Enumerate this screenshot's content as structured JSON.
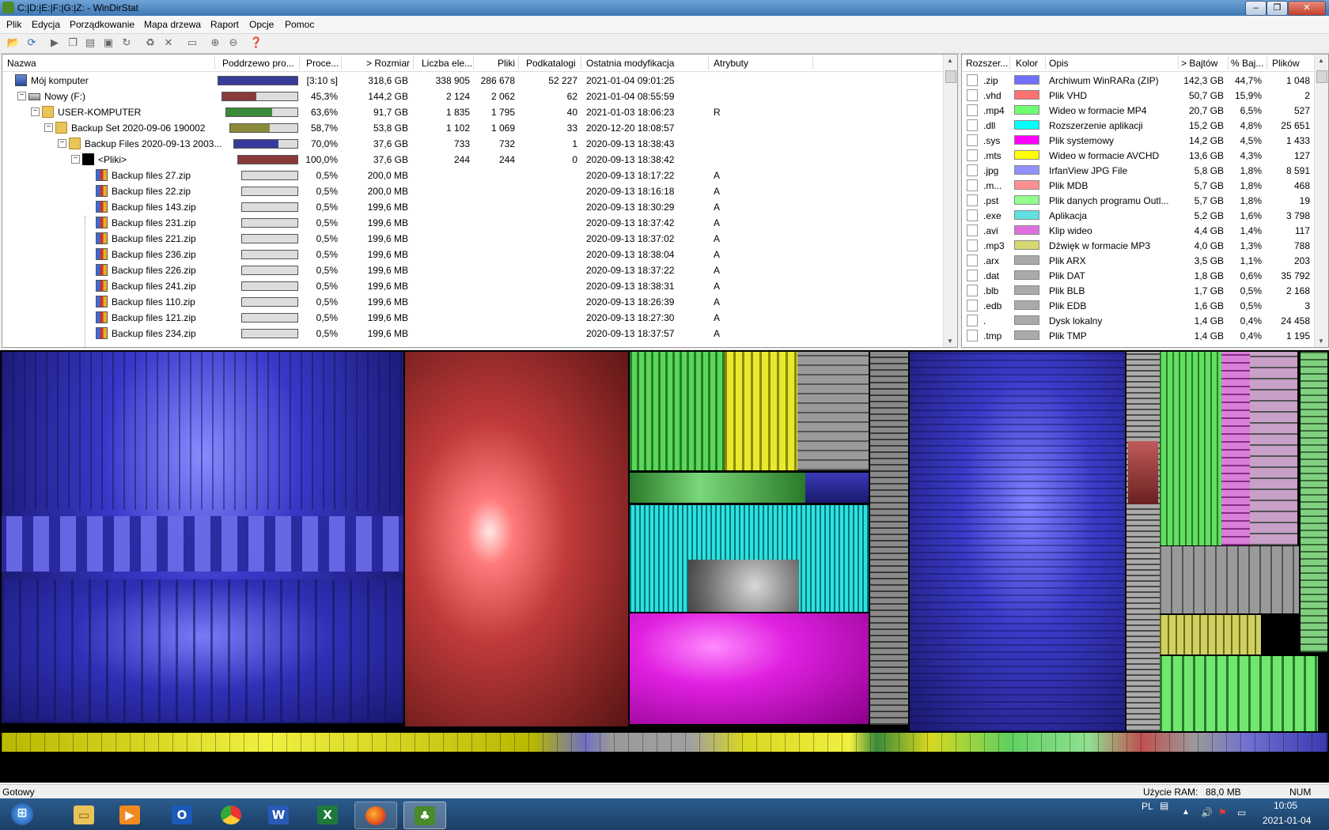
{
  "window": {
    "title": "C:|D:|E:|F:|G:|Z: - WinDirStat"
  },
  "menu": [
    "Plik",
    "Edycja",
    "Porządkowanie",
    "Mapa drzewa",
    "Raport",
    "Opcje",
    "Pomoc"
  ],
  "toolbar_icons": [
    "open-icon",
    "refresh-icon",
    "play-icon",
    "copy-icon",
    "paste-icon",
    "cmd-icon",
    "undo-icon",
    "recycle-icon",
    "delete-icon",
    "folder-icon",
    "zoom-in-icon",
    "zoom-out-icon",
    "help-icon"
  ],
  "tree": {
    "columns": [
      "Nazwa",
      "Poddrzewo pro...",
      "Proce...",
      "> Rozmiar",
      "Liczba ele...",
      "Pliki",
      "Podkatalogi",
      "Ostatnia modyfikacja",
      "Atrybuty"
    ],
    "rows": [
      {
        "name": "Mój komputer",
        "level": 0,
        "expander": "",
        "icon": "computer-icon",
        "percent": "[3:10 s]",
        "size": "318,6 GB",
        "items": "338 905",
        "files": "286 678",
        "subdirs": "52 227",
        "modified": "2021-01-04  09:01:25",
        "attr": "",
        "bar": 1.0,
        "barcolor": "#3a3a9a"
      },
      {
        "name": "Nowy (F:)",
        "level": 1,
        "expander": "−",
        "icon": "drive-icon",
        "percent": "45,3%",
        "size": "144,2 GB",
        "items": "2 124",
        "files": "2 062",
        "subdirs": "62",
        "modified": "2021-01-04  08:55:59",
        "attr": "",
        "bar": 0.453,
        "barcolor": "#8a3a3a"
      },
      {
        "name": "USER-KOMPUTER",
        "level": 2,
        "expander": "−",
        "icon": "folder-icon",
        "percent": "63,6%",
        "size": "91,7 GB",
        "items": "1 835",
        "files": "1 795",
        "subdirs": "40",
        "modified": "2021-01-03  18:06:23",
        "attr": "R",
        "bar": 0.636,
        "barcolor": "#3a8a3a"
      },
      {
        "name": "Backup Set 2020-09-06 190002",
        "level": 3,
        "expander": "−",
        "icon": "folder-icon",
        "percent": "58,7%",
        "size": "53,8 GB",
        "items": "1 102",
        "files": "1 069",
        "subdirs": "33",
        "modified": "2020-12-20  18:08:57",
        "attr": "",
        "bar": 0.587,
        "barcolor": "#8a8a3a"
      },
      {
        "name": "Backup Files 2020-09-13 2003...",
        "level": 4,
        "expander": "−",
        "icon": "folder-icon",
        "percent": "70,0%",
        "size": "37,6 GB",
        "items": "733",
        "files": "732",
        "subdirs": "1",
        "modified": "2020-09-13  18:38:43",
        "attr": "",
        "bar": 0.7,
        "barcolor": "#3a3a9a"
      },
      {
        "name": "<Pliki>",
        "level": 5,
        "expander": "−",
        "icon": "files-icon",
        "percent": "100,0%",
        "size": "37,6 GB",
        "items": "244",
        "files": "244",
        "subdirs": "0",
        "modified": "2020-09-13  18:38:42",
        "attr": "",
        "bar": 1.0,
        "barcolor": "#8a3a3a"
      },
      {
        "name": "Backup files 27.zip",
        "level": 6,
        "expander": "",
        "icon": "zip-icon",
        "percent": "0,5%",
        "size": "200,0 MB",
        "items": "",
        "files": "",
        "subdirs": "",
        "modified": "2020-09-13  18:17:22",
        "attr": "A",
        "bar": 0,
        "barcolor": "#888"
      },
      {
        "name": "Backup files 22.zip",
        "level": 6,
        "expander": "",
        "icon": "zip-icon",
        "percent": "0,5%",
        "size": "200,0 MB",
        "items": "",
        "files": "",
        "subdirs": "",
        "modified": "2020-09-13  18:16:18",
        "attr": "A",
        "bar": 0,
        "barcolor": "#888"
      },
      {
        "name": "Backup files 143.zip",
        "level": 6,
        "expander": "",
        "icon": "zip-icon",
        "percent": "0,5%",
        "size": "199,6 MB",
        "items": "",
        "files": "",
        "subdirs": "",
        "modified": "2020-09-13  18:30:29",
        "attr": "A",
        "bar": 0,
        "barcolor": "#888"
      },
      {
        "name": "Backup files 231.zip",
        "level": 6,
        "expander": "",
        "icon": "zip-icon",
        "percent": "0,5%",
        "size": "199,6 MB",
        "items": "",
        "files": "",
        "subdirs": "",
        "modified": "2020-09-13  18:37:42",
        "attr": "A",
        "bar": 0,
        "barcolor": "#888"
      },
      {
        "name": "Backup files 221.zip",
        "level": 6,
        "expander": "",
        "icon": "zip-icon",
        "percent": "0,5%",
        "size": "199,6 MB",
        "items": "",
        "files": "",
        "subdirs": "",
        "modified": "2020-09-13  18:37:02",
        "attr": "A",
        "bar": 0,
        "barcolor": "#888"
      },
      {
        "name": "Backup files 236.zip",
        "level": 6,
        "expander": "",
        "icon": "zip-icon",
        "percent": "0,5%",
        "size": "199,6 MB",
        "items": "",
        "files": "",
        "subdirs": "",
        "modified": "2020-09-13  18:38:04",
        "attr": "A",
        "bar": 0,
        "barcolor": "#888"
      },
      {
        "name": "Backup files 226.zip",
        "level": 6,
        "expander": "",
        "icon": "zip-icon",
        "percent": "0,5%",
        "size": "199,6 MB",
        "items": "",
        "files": "",
        "subdirs": "",
        "modified": "2020-09-13  18:37:22",
        "attr": "A",
        "bar": 0,
        "barcolor": "#888"
      },
      {
        "name": "Backup files 241.zip",
        "level": 6,
        "expander": "",
        "icon": "zip-icon",
        "percent": "0,5%",
        "size": "199,6 MB",
        "items": "",
        "files": "",
        "subdirs": "",
        "modified": "2020-09-13  18:38:31",
        "attr": "A",
        "bar": 0,
        "barcolor": "#888"
      },
      {
        "name": "Backup files 110.zip",
        "level": 6,
        "expander": "",
        "icon": "zip-icon",
        "percent": "0,5%",
        "size": "199,6 MB",
        "items": "",
        "files": "",
        "subdirs": "",
        "modified": "2020-09-13  18:26:39",
        "attr": "A",
        "bar": 0,
        "barcolor": "#888"
      },
      {
        "name": "Backup files 121.zip",
        "level": 6,
        "expander": "",
        "icon": "zip-icon",
        "percent": "0,5%",
        "size": "199,6 MB",
        "items": "",
        "files": "",
        "subdirs": "",
        "modified": "2020-09-13  18:27:30",
        "attr": "A",
        "bar": 0,
        "barcolor": "#888"
      },
      {
        "name": "Backup files 234.zip",
        "level": 6,
        "expander": "",
        "icon": "zip-icon",
        "percent": "0,5%",
        "size": "199,6 MB",
        "items": "",
        "files": "",
        "subdirs": "",
        "modified": "2020-09-13  18:37:57",
        "attr": "A",
        "bar": 0,
        "barcolor": "#888"
      }
    ]
  },
  "extensions": {
    "columns": [
      "Rozszer...",
      "Kolor",
      "Opis",
      "> Bajtów",
      "% Baj...",
      "Plików"
    ],
    "rows": [
      {
        "ext": ".zip",
        "color": "#7070ff",
        "desc": "Archiwum WinRARa (ZIP)",
        "bytes": "142,3 GB",
        "pct": "44,7%",
        "files": "1 048"
      },
      {
        "ext": ".vhd",
        "color": "#ff7070",
        "desc": "Plik VHD",
        "bytes": "50,7 GB",
        "pct": "15,9%",
        "files": "2"
      },
      {
        "ext": ".mp4",
        "color": "#70ff70",
        "desc": "Wideo w formacie MP4",
        "bytes": "20,7 GB",
        "pct": "6,5%",
        "files": "527"
      },
      {
        "ext": ".dll",
        "color": "#00ffff",
        "desc": "Rozszerzenie aplikacji",
        "bytes": "15,2 GB",
        "pct": "4,8%",
        "files": "25 651"
      },
      {
        "ext": ".sys",
        "color": "#ff00ff",
        "desc": "Plik systemowy",
        "bytes": "14,2 GB",
        "pct": "4,5%",
        "files": "1 433"
      },
      {
        "ext": ".mts",
        "color": "#ffff00",
        "desc": "Wideo w formacie AVCHD",
        "bytes": "13,6 GB",
        "pct": "4,3%",
        "files": "127"
      },
      {
        "ext": ".jpg",
        "color": "#9090ff",
        "desc": "IrfanView JPG File",
        "bytes": "5,8 GB",
        "pct": "1,8%",
        "files": "8 591"
      },
      {
        "ext": ".m...",
        "color": "#ff9090",
        "desc": "Plik MDB",
        "bytes": "5,7 GB",
        "pct": "1,8%",
        "files": "468"
      },
      {
        "ext": ".pst",
        "color": "#90ff90",
        "desc": "Plik danych programu Outl...",
        "bytes": "5,7 GB",
        "pct": "1,8%",
        "files": "19"
      },
      {
        "ext": ".exe",
        "color": "#60e0e0",
        "desc": "Aplikacja",
        "bytes": "5,2 GB",
        "pct": "1,6%",
        "files": "3 798"
      },
      {
        "ext": ".avi",
        "color": "#e070e0",
        "desc": "Klip wideo",
        "bytes": "4,4 GB",
        "pct": "1,4%",
        "files": "117"
      },
      {
        "ext": ".mp3",
        "color": "#d8d870",
        "desc": "Dźwięk w formacie MP3",
        "bytes": "4,0 GB",
        "pct": "1,3%",
        "files": "788"
      },
      {
        "ext": ".arx",
        "color": "#aaaaaa",
        "desc": "Plik ARX",
        "bytes": "3,5 GB",
        "pct": "1,1%",
        "files": "203"
      },
      {
        "ext": ".dat",
        "color": "#aaaaaa",
        "desc": "Plik DAT",
        "bytes": "1,8 GB",
        "pct": "0,6%",
        "files": "35 792"
      },
      {
        "ext": ".blb",
        "color": "#aaaaaa",
        "desc": "Plik BLB",
        "bytes": "1,7 GB",
        "pct": "0,5%",
        "files": "2 168"
      },
      {
        "ext": ".edb",
        "color": "#aaaaaa",
        "desc": "Plik EDB",
        "bytes": "1,6 GB",
        "pct": "0,5%",
        "files": "3"
      },
      {
        "ext": ".",
        "color": "#aaaaaa",
        "desc": "Dysk lokalny",
        "bytes": "1,4 GB",
        "pct": "0,4%",
        "files": "24 458"
      },
      {
        "ext": ".tmp",
        "color": "#aaaaaa",
        "desc": "Plik TMP",
        "bytes": "1,4 GB",
        "pct": "0,4%",
        "files": "1 195"
      }
    ]
  },
  "status": {
    "text": "Gotowy",
    "ram_label": "Użycie RAM:",
    "ram_value": "88,0 MB",
    "num": "NUM"
  },
  "taskbar": {
    "apps": [
      "start-button",
      "explorer-icon",
      "media-player-icon",
      "outlook-icon",
      "chrome-icon",
      "word-icon",
      "excel-icon",
      "firefox-icon",
      "windirstat-icon"
    ],
    "lang": "PL",
    "time": "10:05",
    "date": "2021-01-04"
  }
}
